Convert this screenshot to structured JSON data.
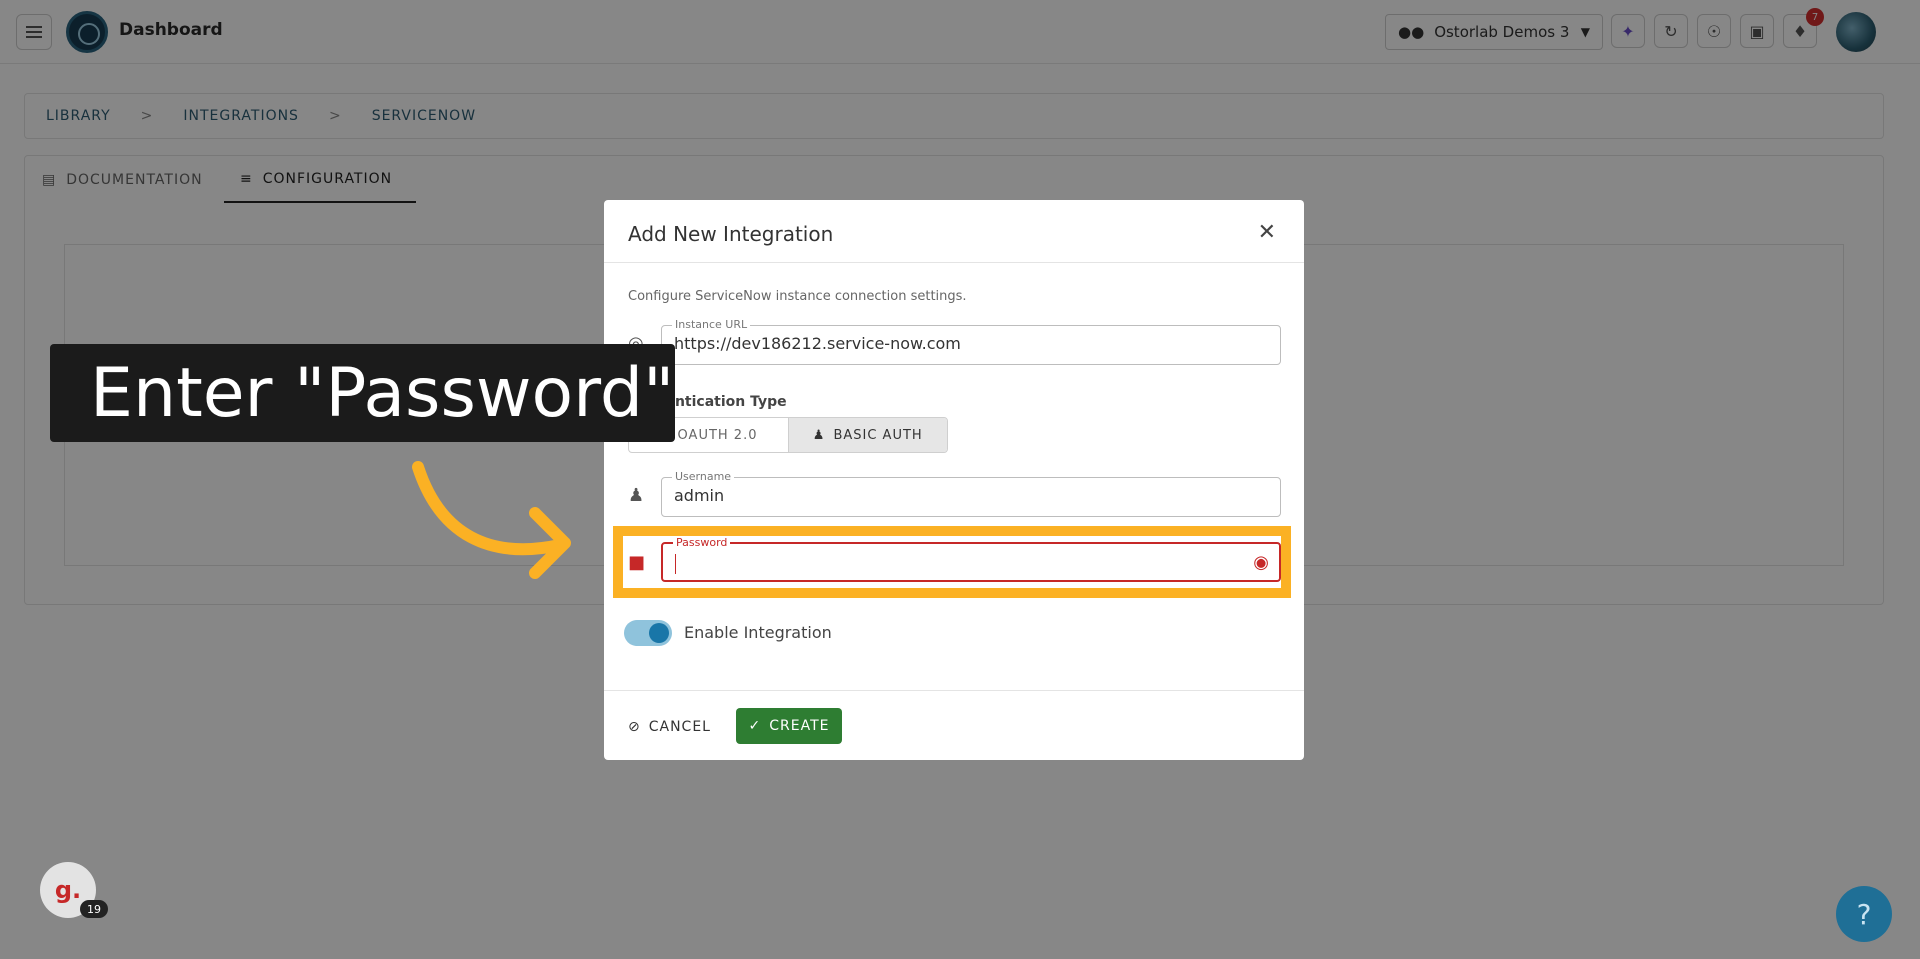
{
  "topbar": {
    "title": "Dashboard",
    "org_name": "Ostorlab Demos 3",
    "notification_count": "7"
  },
  "breadcrumb": {
    "items": [
      "LIBRARY",
      "INTEGRATIONS",
      "SERVICENOW"
    ],
    "separator": ">"
  },
  "tabs": {
    "documentation": "DOCUMENTATION",
    "configuration": "CONFIGURATION"
  },
  "dialog": {
    "title": "Add New Integration",
    "description": "Configure ServiceNow instance connection settings.",
    "instance_url": {
      "label": "Instance URL",
      "value": "https://dev186212.service-now.com"
    },
    "auth_type_label": "Authentication Type",
    "auth_options": [
      "OAUTH 2.0",
      "BASIC AUTH"
    ],
    "username": {
      "label": "Username",
      "value": "admin"
    },
    "password": {
      "label": "Password",
      "value": ""
    },
    "enable_label": "Enable Integration",
    "enabled": true,
    "cancel_label": "CANCEL",
    "create_label": "CREATE"
  },
  "annotation": {
    "text": "Enter \"Password\"",
    "highlight_color": "#fbb124"
  },
  "widgets": {
    "guide_letter": "g.",
    "guide_count": "19",
    "help_label": "?"
  }
}
